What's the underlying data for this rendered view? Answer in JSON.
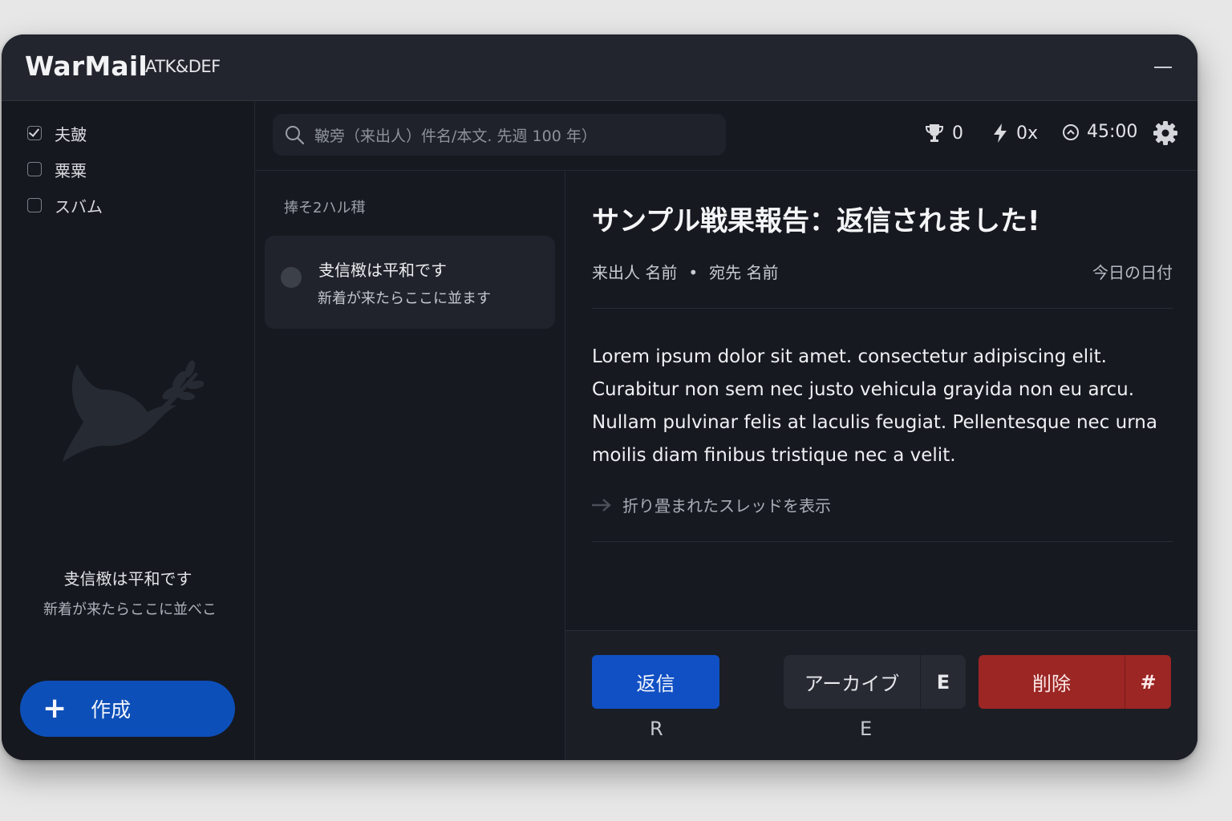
{
  "app": {
    "title": "WarMail",
    "subtitle": "ATK&DEF"
  },
  "sidebar": {
    "folders": [
      {
        "label": "夫皷",
        "checked": true
      },
      {
        "label": "粟粟",
        "checked": false
      },
      {
        "label": "スバム",
        "checked": false
      }
    ],
    "empty_title": "叏信㮹は平和です",
    "empty_subtitle": "新着が来たらここに並べこ",
    "compose_label": "作成"
  },
  "toolbar": {
    "search_placeholder": "鞁旁（来出人）件名/本文. 先週 100 年）",
    "score": "0",
    "multiplier": "0x",
    "timer": "45:00"
  },
  "list": {
    "header": "捧そ2ハル穁",
    "items": [
      {
        "title": "叏信㮹は平和です",
        "preview": "新着が来たらここに並ます"
      }
    ]
  },
  "reader": {
    "subject": "サンプル戦果報告：返信されました!",
    "sender": "来出人 名前",
    "recipient": "宛先 名前",
    "date": "今日の日付",
    "body": "Lorem ipsum dolor sit amet. consectetur adipiscing elit. Curabitur non sem nec justo vehicula grayida non eu arcu. Nullam pulvinar felis at laculis feugiat. Pellentesque nec urna moilis diam finibus tristique nec a velit.",
    "thread_link": "折り畳まれたスレッドを表示"
  },
  "actions": {
    "reply_label": "返信",
    "reply_key": "R",
    "archive_label": "アーカイブ",
    "archive_key": "E",
    "archive_hint": "E",
    "delete_label": "削除",
    "delete_key": "#"
  },
  "colors": {
    "accent": "#1150c4",
    "danger": "#9b2624",
    "background": "#161920"
  }
}
